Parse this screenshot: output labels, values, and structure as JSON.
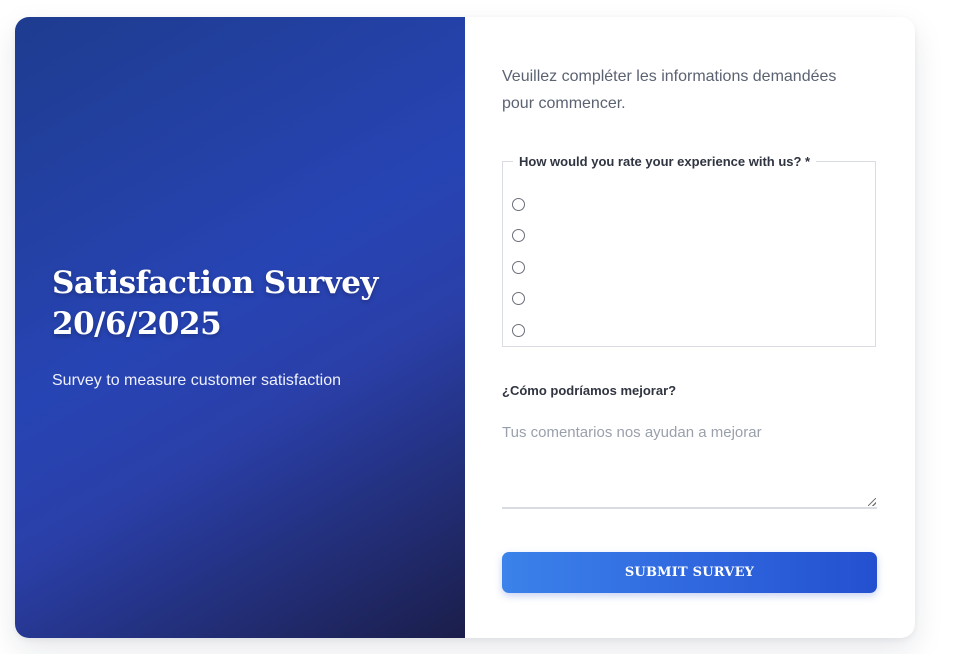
{
  "hero": {
    "title": "Satisfaction Survey 20/6/2025",
    "subtitle": "Survey to measure customer satisfaction"
  },
  "form": {
    "intro": "Veuillez compléter les informations demandées pour commencer.",
    "rating_question": "How would you rate your experience with us? *",
    "rating_options_count": 5,
    "improve_label": "¿Cómo podríamos mejorar?",
    "comments_placeholder": "Tus comentarios nos ayudan a mejorar",
    "submit_label": "SUBMIT SURVEY"
  },
  "colors": {
    "hero_gradient_start": "#1e3c8f",
    "hero_gradient_mid": "#2744b4",
    "hero_gradient_end": "#1b1e4a",
    "button_start": "#3b82ea",
    "button_end": "#2450cf"
  }
}
